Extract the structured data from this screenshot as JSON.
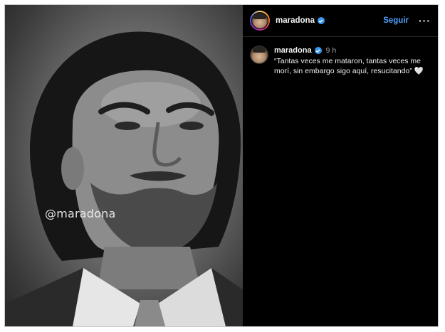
{
  "post": {
    "watermark": "@maradona",
    "header": {
      "username": "maradona",
      "follow_label": "Seguir",
      "more_label": "···"
    },
    "caption": {
      "username": "maradona",
      "time": "9 h",
      "text": "“Tantas veces me mataron, tantas veces me morí, sin embargo sigo aquí, resucitando”",
      "emoji": "🤍"
    }
  },
  "colors": {
    "background": "#000000",
    "accent_link": "#4da3ff",
    "verified_badge": "#3897f0"
  },
  "icons": {
    "verified": "verified-badge-icon",
    "more": "more-options-icon"
  }
}
